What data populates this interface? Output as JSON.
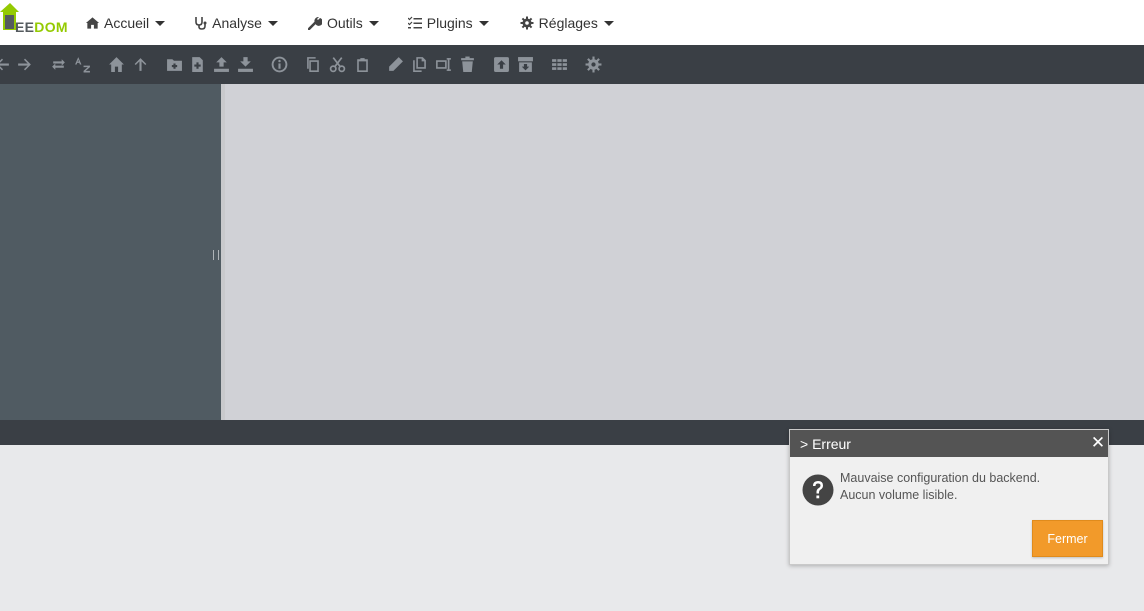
{
  "brand": {
    "logo_prefix": "EE",
    "logo_suffix": "DOM"
  },
  "nav": {
    "items": [
      {
        "label": "Accueil",
        "icon": "home-icon"
      },
      {
        "label": "Analyse",
        "icon": "stethoscope-icon"
      },
      {
        "label": "Outils",
        "icon": "wrench-icon"
      },
      {
        "label": "Plugins",
        "icon": "list-check-icon"
      },
      {
        "label": "Réglages",
        "icon": "gear-icon"
      }
    ]
  },
  "toolbar": {
    "icons": [
      "back-icon",
      "forward-icon",
      "refresh-icon",
      "sort-az-icon",
      "home-icon",
      "up-icon",
      "new-folder-icon",
      "new-file-icon",
      "upload-icon",
      "download-icon",
      "info-icon",
      "copy-icon",
      "cut-icon",
      "paste-icon",
      "rename-icon",
      "duplicate-icon",
      "edit-icon",
      "delete-icon",
      "extract-icon",
      "archive-icon",
      "view-icon",
      "settings-icon"
    ]
  },
  "dialog": {
    "title": "> Erreur",
    "close_symbol": "✕",
    "message_line1": "Mauvaise configuration du backend.",
    "message_line2": "Aucun volume lisible.",
    "button_label": "Fermer"
  },
  "colors": {
    "navbar": "#ffffff",
    "toolbar": "#3a3f45",
    "sidebar": "#505b62",
    "content": "#d0d1d6",
    "accent_button": "#f29a2a",
    "logo_green": "#94ca02"
  }
}
